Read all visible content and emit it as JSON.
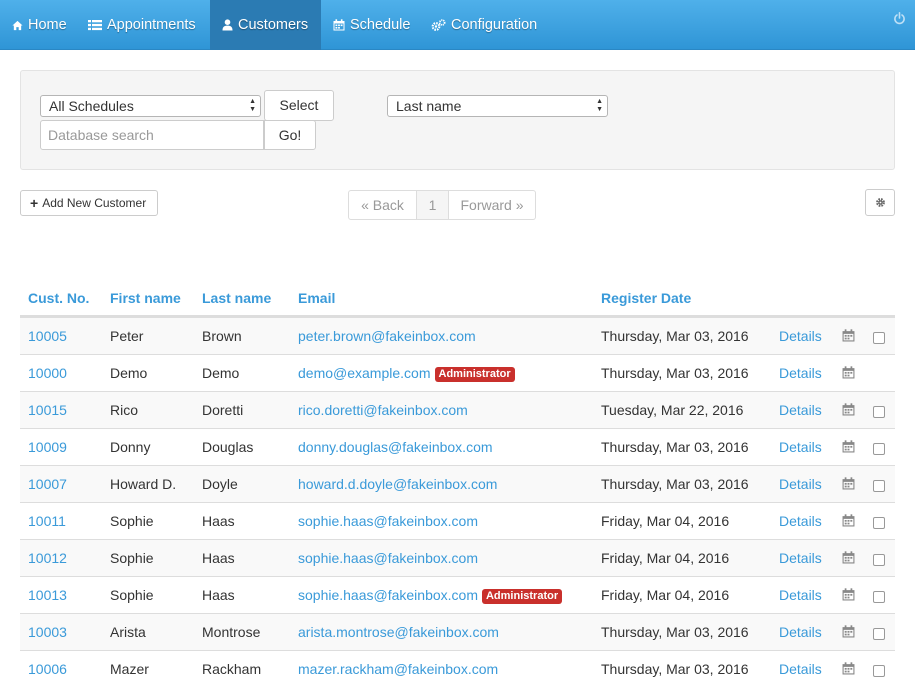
{
  "nav": {
    "home": "Home",
    "appointments": "Appointments",
    "customers": "Customers",
    "schedule": "Schedule",
    "configuration": "Configuration"
  },
  "filters": {
    "schedule_select": "All Schedules",
    "select_button": "Select",
    "search_placeholder": "Database search",
    "go_button": "Go!",
    "sort_select": "Last name"
  },
  "toolbar": {
    "add_customer": "Add New Customer",
    "pager_back": "« Back",
    "pager_page": "1",
    "pager_forward": "Forward »"
  },
  "table": {
    "headers": {
      "cust_no": "Cust. No.",
      "first_name": "First name",
      "last_name": "Last name",
      "email": "Email",
      "register_date": "Register Date"
    },
    "details_label": "Details",
    "rows": [
      {
        "id": "10005",
        "first": "Peter",
        "last": "Brown",
        "email": "peter.brown@fakeinbox.com",
        "badge": "",
        "date": "Thursday, Mar 03, 2016",
        "checkbox": true
      },
      {
        "id": "10000",
        "first": "Demo",
        "last": "Demo",
        "email": "demo@example.com",
        "badge": "Administrator",
        "date": "Thursday, Mar 03, 2016",
        "checkbox": false
      },
      {
        "id": "10015",
        "first": "Rico",
        "last": "Doretti",
        "email": "rico.doretti@fakeinbox.com",
        "badge": "",
        "date": "Tuesday, Mar 22, 2016",
        "checkbox": true
      },
      {
        "id": "10009",
        "first": "Donny",
        "last": "Douglas",
        "email": "donny.douglas@fakeinbox.com",
        "badge": "",
        "date": "Thursday, Mar 03, 2016",
        "checkbox": true
      },
      {
        "id": "10007",
        "first": "Howard D.",
        "last": "Doyle",
        "email": "howard.d.doyle@fakeinbox.com",
        "badge": "",
        "date": "Thursday, Mar 03, 2016",
        "checkbox": true
      },
      {
        "id": "10011",
        "first": "Sophie",
        "last": "Haas",
        "email": "sophie.haas@fakeinbox.com",
        "badge": "",
        "date": "Friday, Mar 04, 2016",
        "checkbox": true
      },
      {
        "id": "10012",
        "first": "Sophie",
        "last": "Haas",
        "email": "sophie.haas@fakeinbox.com",
        "badge": "",
        "date": "Friday, Mar 04, 2016",
        "checkbox": true
      },
      {
        "id": "10013",
        "first": "Sophie",
        "last": "Haas",
        "email": "sophie.haas@fakeinbox.com",
        "badge": "Administrator",
        "date": "Friday, Mar 04, 2016",
        "checkbox": true
      },
      {
        "id": "10003",
        "first": "Arista",
        "last": "Montrose",
        "email": "arista.montrose@fakeinbox.com",
        "badge": "",
        "date": "Thursday, Mar 03, 2016",
        "checkbox": true
      },
      {
        "id": "10006",
        "first": "Mazer",
        "last": "Rackham",
        "email": "mazer.rackham@fakeinbox.com",
        "badge": "",
        "date": "Thursday, Mar 03, 2016",
        "checkbox": true
      }
    ]
  },
  "colors": {
    "navbar": "#3a9ad9",
    "link": "#3a9ad9",
    "badge": "#c9302c"
  },
  "icons": {
    "home": "home-icon",
    "appointments": "list-icon",
    "customers": "user-icon",
    "schedule": "calendar-icon",
    "configuration": "gears-icon",
    "logout": "power-icon",
    "settings": "gear-icon",
    "add": "plus-icon"
  }
}
